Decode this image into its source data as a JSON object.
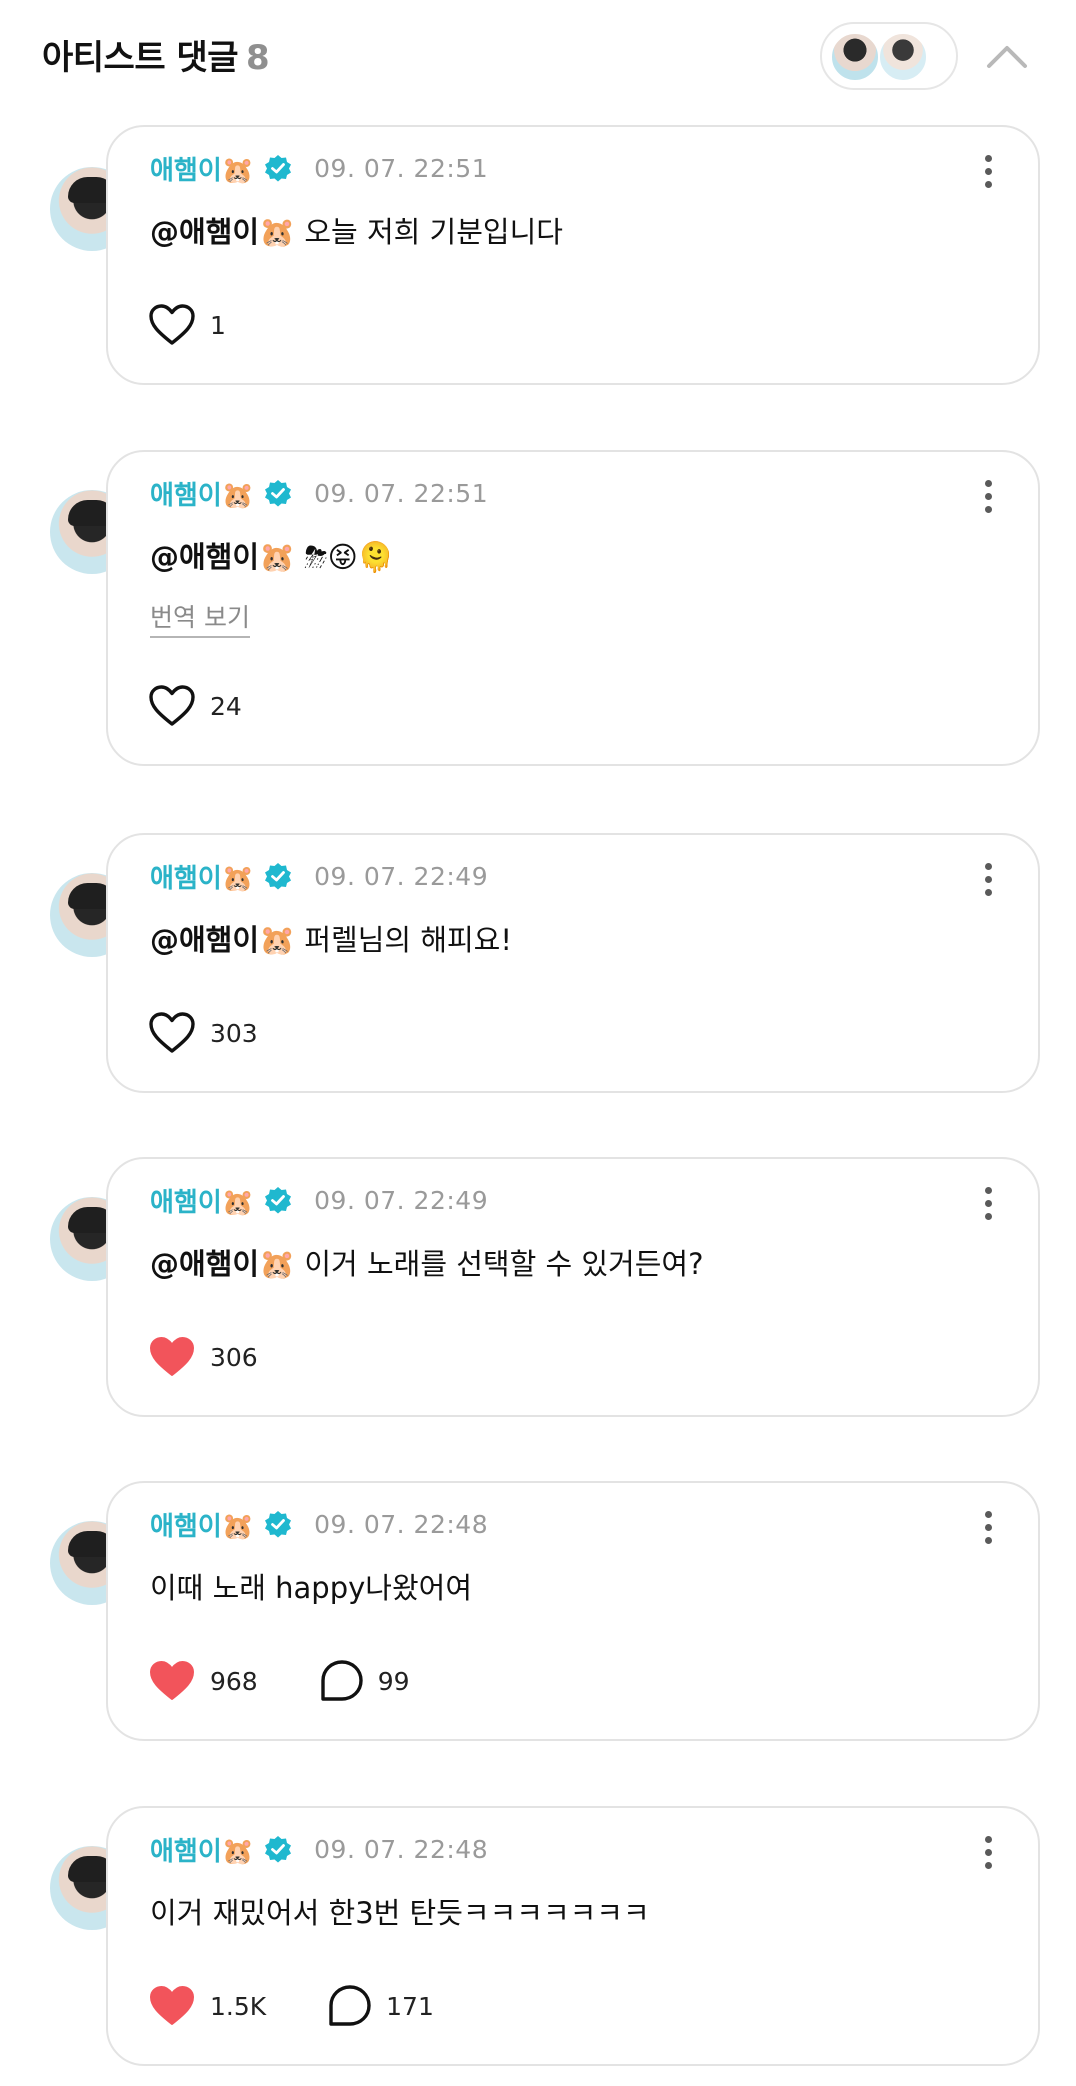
{
  "header": {
    "title": "아티스트 댓글",
    "count": "8"
  },
  "comments": [
    {
      "author": "애햄이🐹",
      "time": "09. 07. 22:51",
      "mention": "@애햄이🐹",
      "body": " 오늘 저희 기분입니다",
      "translate": "",
      "likes": "1",
      "liked": false,
      "replies": ""
    },
    {
      "author": "애햄이🐹",
      "time": "09. 07. 22:51",
      "mention": "@애햄이🐹",
      "body": " ⛈😝🫠",
      "translate": "번역 보기",
      "likes": "24",
      "liked": false,
      "replies": ""
    },
    {
      "author": "애햄이🐹",
      "time": "09. 07. 22:49",
      "mention": "@애햄이🐹",
      "body": " 퍼렐님의 해피요!",
      "translate": "",
      "likes": "303",
      "liked": false,
      "replies": ""
    },
    {
      "author": "애햄이🐹",
      "time": "09. 07. 22:49",
      "mention": "@애햄이🐹",
      "body": " 이거 노래를 선택할 수 있거든여?",
      "translate": "",
      "likes": "306",
      "liked": true,
      "replies": ""
    },
    {
      "author": "애햄이🐹",
      "time": "09. 07. 22:48",
      "mention": "",
      "body": "이때 노래 happy나왔어여",
      "translate": "",
      "likes": "968",
      "liked": true,
      "replies": "99"
    },
    {
      "author": "애햄이🐹",
      "time": "09. 07. 22:48",
      "mention": "",
      "body": "이거 재밌어서 한3번 탄듯ㅋㅋㅋㅋㅋㅋㅋ",
      "translate": "",
      "likes": "1.5K",
      "liked": true,
      "replies": "171"
    }
  ],
  "colors": {
    "author": "#2bb3c8",
    "verified": "#1fb8cf",
    "liked_heart": "#f2545b",
    "border": "#e3e3e3"
  },
  "icons": {
    "verified": "verified-badge-icon",
    "more": "more-vertical-icon",
    "like": "heart-icon",
    "reply": "reply-bubble-icon",
    "collapse": "chevron-up-icon"
  }
}
